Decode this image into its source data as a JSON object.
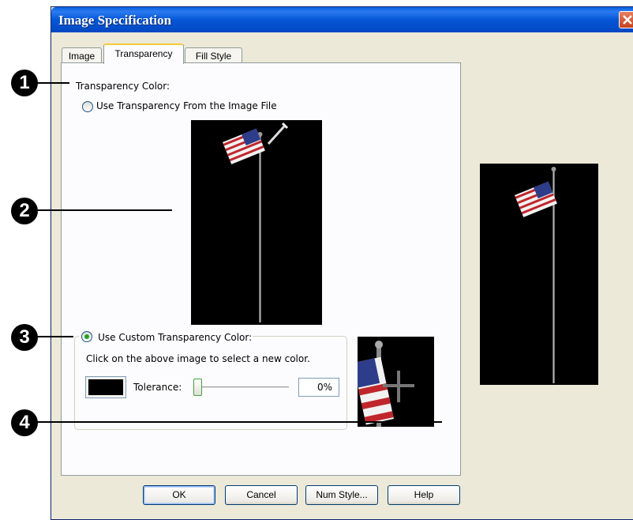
{
  "window": {
    "title": "Image Specification"
  },
  "tabs": [
    {
      "label": "Image"
    },
    {
      "label": "Transparency"
    },
    {
      "label": "Fill Style"
    }
  ],
  "transparency": {
    "section_label": "Transparency Color:",
    "use_file_label": "Use Transparency From the Image File",
    "use_custom_label": "Use Custom Transparency Color:",
    "instruction": "Click on the above image to select a new color.",
    "tolerance_label": "Tolerance:",
    "tolerance_value": "0%",
    "tolerance_fraction": 0,
    "selected_color": "#000000"
  },
  "buttons": {
    "ok": "OK",
    "cancel": "Cancel",
    "num_style": "Num Style...",
    "help": "Help"
  },
  "callouts": [
    "1",
    "2",
    "3",
    "4"
  ],
  "colors": {
    "titlebar": "#0456D6",
    "dialog_bg": "#ECE9D8",
    "tab_highlight": "#FFC83C",
    "close_button": "#C7411E"
  }
}
